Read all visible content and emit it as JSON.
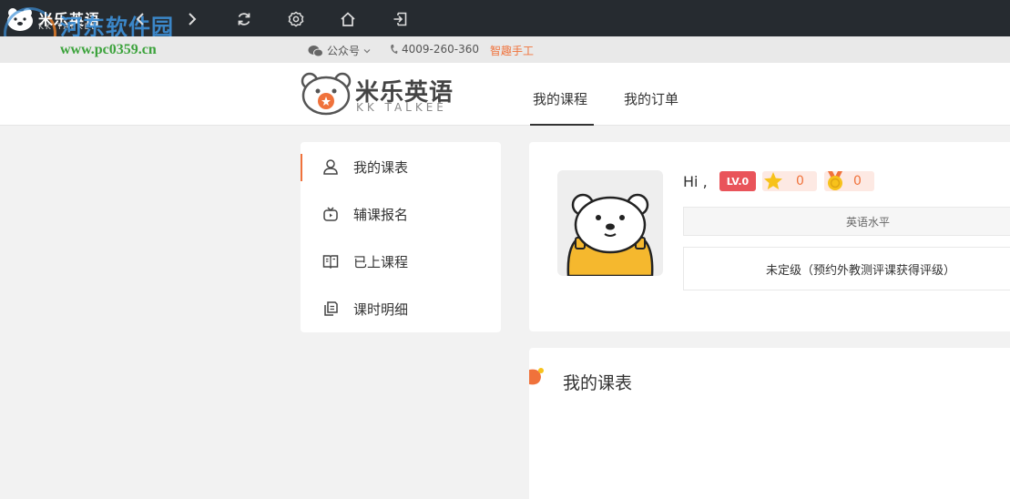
{
  "titlebar": {
    "logo_text": "米乐英语",
    "logo_sub": "KK TALKEE",
    "watermark_text": "河东软件园",
    "watermark_url": "www.pc0359.cn"
  },
  "infobar": {
    "wechat_label": "公众号",
    "phone": "4009-260-360",
    "craft_link": "智趣手工"
  },
  "header": {
    "brand_name": "米乐英语",
    "brand_sub": "KK TALKEE",
    "tabs": [
      {
        "label": "我的课程",
        "active": true
      },
      {
        "label": "我的订单",
        "active": false
      }
    ]
  },
  "sidebar": {
    "items": [
      {
        "label": "我的课表",
        "icon": "user-icon",
        "active": true
      },
      {
        "label": "辅课报名",
        "icon": "tv-icon",
        "active": false
      },
      {
        "label": "已上课程",
        "icon": "book-icon",
        "active": false
      },
      {
        "label": "课时明细",
        "icon": "copy-icon",
        "active": false
      }
    ]
  },
  "profile": {
    "greeting": "Hi ,",
    "level_badge": "LV.0",
    "stars": "0",
    "medals": "0",
    "level_header": "英语水平",
    "level_text": "未定级（预约外教测评课获得评级）"
  },
  "schedule": {
    "title": "我的课表"
  },
  "colors": {
    "accent": "#f0723b",
    "titlebar_bg": "#262b30",
    "badge_red": "#e9545a"
  }
}
